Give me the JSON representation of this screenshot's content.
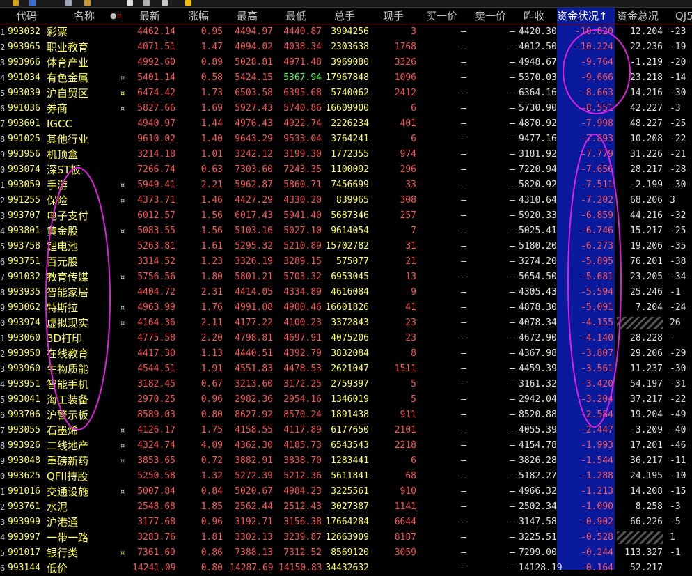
{
  "toolbar": {
    "icons": [
      "bell-icon",
      "bookmark-icon",
      "document-icon",
      "export-icon",
      "settings-icon",
      "grid-icon",
      "warning-icon"
    ]
  },
  "header": {
    "code": "代码",
    "name": "名称",
    "mark": "●¤",
    "latest": "最新",
    "change": "涨幅",
    "high": "最高",
    "low": "最低",
    "volume": "总手",
    "current": "现手",
    "bid": "买一价",
    "ask": "卖一价",
    "prev_close": "昨收",
    "fund_status": "资金状况↑",
    "fund_total": "资金总况",
    "qj": "QJ5"
  },
  "rows": [
    {
      "idx": "1",
      "code": "993032",
      "name": "彩票",
      "mark": "",
      "latest": "4462.14",
      "chg": "0.95",
      "high": "4494.97",
      "low": "4440.87",
      "vol": "3994256",
      "cur": "3",
      "bid": "–",
      "ask": "–",
      "prev": "4420.30",
      "fstat": "-10.820",
      "ftot": "12.204",
      "qj": "-23"
    },
    {
      "idx": "2",
      "code": "993965",
      "name": "职业教育",
      "mark": "",
      "latest": "4071.51",
      "chg": "1.47",
      "high": "4094.02",
      "low": "4038.34",
      "vol": "2303638",
      "cur": "1768",
      "bid": "–",
      "ask": "–",
      "prev": "4012.50",
      "fstat": "-10.224",
      "ftot": "22.236",
      "qj": "-19"
    },
    {
      "idx": "3",
      "code": "993966",
      "name": "体育产业",
      "mark": "",
      "latest": "4992.60",
      "chg": "0.89",
      "high": "5028.81",
      "low": "4971.48",
      "vol": "3969080",
      "cur": "3326",
      "bid": "–",
      "ask": "–",
      "prev": "4948.67",
      "fstat": "-9.764",
      "ftot": "-1.219",
      "qj": "-20"
    },
    {
      "idx": "4",
      "code": "991034",
      "name": "有色金属",
      "mark": "¤",
      "latest": "5401.14",
      "chg": "0.58",
      "high": "5424.15",
      "low": "5367.94",
      "lowGreen": true,
      "vol": "17967848",
      "cur": "1096",
      "bid": "–",
      "ask": "–",
      "prev": "5370.03",
      "fstat": "-9.666",
      "ftot": "23.218",
      "qj": "-14"
    },
    {
      "idx": "5",
      "code": "993039",
      "name": "沪自贸区",
      "mark": "¤",
      "markHl": true,
      "latest": "6474.42",
      "chg": "1.73",
      "high": "6503.58",
      "low": "6395.68",
      "vol": "5740062",
      "cur": "2412",
      "bid": "–",
      "ask": "–",
      "prev": "6364.16",
      "fstat": "-8.663",
      "ftot": "14.216",
      "qj": "-30"
    },
    {
      "idx": "6",
      "code": "991036",
      "name": "券商",
      "mark": "¤",
      "latest": "5827.66",
      "chg": "1.69",
      "high": "5927.43",
      "low": "5740.86",
      "vol": "16609900",
      "cur": "6",
      "bid": "–",
      "ask": "–",
      "prev": "5730.90",
      "fstat": "-8.551",
      "ftot": "42.227",
      "qj": "-3"
    },
    {
      "idx": "7",
      "code": "993601",
      "name": "IGCC",
      "mark": "",
      "latest": "4940.97",
      "chg": "1.44",
      "high": "4976.43",
      "low": "4922.74",
      "vol": "2226234",
      "cur": "401",
      "bid": "–",
      "ask": "–",
      "prev": "4870.92",
      "fstat": "-7.998",
      "ftot": "48.227",
      "qj": "-25"
    },
    {
      "idx": "8",
      "code": "991025",
      "name": "其他行业",
      "mark": "",
      "latest": "9610.02",
      "chg": "1.40",
      "high": "9643.29",
      "low": "9533.04",
      "vol": "3764241",
      "cur": "6",
      "bid": "–",
      "ask": "–",
      "prev": "9477.16",
      "fstat": "-7.893",
      "ftot": "10.208",
      "qj": "-22"
    },
    {
      "idx": "9",
      "code": "993956",
      "name": "机顶盒",
      "mark": "",
      "latest": "3214.18",
      "chg": "1.01",
      "high": "3242.12",
      "low": "3199.30",
      "vol": "1772355",
      "cur": "974",
      "bid": "–",
      "ask": "–",
      "prev": "3181.92",
      "fstat": "-7.779",
      "ftot": "31.226",
      "qj": "-21"
    },
    {
      "idx": "0",
      "code": "993074",
      "name": "深ST板",
      "mark": "",
      "latest": "7266.74",
      "chg": "0.63",
      "high": "7303.60",
      "low": "7243.35",
      "vol": "1100092",
      "cur": "296",
      "bid": "–",
      "ask": "–",
      "prev": "7220.94",
      "fstat": "-7.656",
      "ftot": "28.217",
      "qj": "-28"
    },
    {
      "idx": "1",
      "code": "993059",
      "name": "手游",
      "mark": "¤",
      "latest": "5949.41",
      "chg": "2.21",
      "high": "5962.87",
      "low": "5860.71",
      "vol": "7456699",
      "cur": "33",
      "bid": "–",
      "ask": "–",
      "prev": "5820.92",
      "fstat": "-7.511",
      "ftot": "-2.199",
      "qj": "-30"
    },
    {
      "idx": "2",
      "code": "991255",
      "name": "保险",
      "mark": "¤",
      "latest": "4373.71",
      "chg": "1.46",
      "high": "4427.29",
      "low": "4330.20",
      "vol": "839965",
      "cur": "308",
      "bid": "–",
      "ask": "–",
      "prev": "4310.64",
      "fstat": "-7.202",
      "ftot": "68.206",
      "qj": "3"
    },
    {
      "idx": "3",
      "code": "993707",
      "name": "电子支付",
      "mark": "",
      "latest": "6012.57",
      "chg": "1.56",
      "high": "6017.43",
      "low": "5941.40",
      "vol": "5687346",
      "cur": "257",
      "bid": "–",
      "ask": "–",
      "prev": "5920.33",
      "fstat": "-6.859",
      "ftot": "44.216",
      "qj": "-32"
    },
    {
      "idx": "4",
      "code": "993801",
      "name": "黄金股",
      "mark": "¤",
      "latest": "5083.55",
      "chg": "1.56",
      "high": "5103.16",
      "low": "5027.10",
      "vol": "9614054",
      "cur": "7",
      "bid": "–",
      "ask": "–",
      "prev": "5025.41",
      "fstat": "-6.746",
      "ftot": "15.217",
      "qj": "-25"
    },
    {
      "idx": "5",
      "code": "993758",
      "name": "锂电池",
      "mark": "",
      "latest": "5263.81",
      "chg": "1.61",
      "high": "5295.32",
      "low": "5210.89",
      "vol": "15702782",
      "cur": "31",
      "bid": "–",
      "ask": "–",
      "prev": "5180.20",
      "fstat": "-6.273",
      "ftot": "19.206",
      "qj": "-35"
    },
    {
      "idx": "6",
      "code": "993751",
      "name": "百元股",
      "mark": "",
      "latest": "3314.52",
      "chg": "1.23",
      "high": "3326.19",
      "low": "3289.15",
      "vol": "575077",
      "cur": "21",
      "bid": "–",
      "ask": "–",
      "prev": "3274.20",
      "fstat": "-5.895",
      "ftot": "76.201",
      "qj": "-38"
    },
    {
      "idx": "7",
      "code": "991032",
      "name": "教育传媒",
      "mark": "¤",
      "latest": "5756.56",
      "chg": "1.80",
      "high": "5801.21",
      "low": "5703.32",
      "vol": "6953045",
      "cur": "13",
      "bid": "–",
      "ask": "–",
      "prev": "5654.50",
      "fstat": "-5.681",
      "ftot": "23.205",
      "qj": "-34"
    },
    {
      "idx": "8",
      "code": "993935",
      "name": "智能家居",
      "mark": "",
      "latest": "4404.72",
      "chg": "2.31",
      "high": "4414.05",
      "low": "4334.89",
      "vol": "4616084",
      "cur": "9",
      "bid": "–",
      "ask": "–",
      "prev": "4305.43",
      "fstat": "-5.594",
      "ftot": "25.246",
      "qj": "-1"
    },
    {
      "idx": "9",
      "code": "993062",
      "name": "特斯拉",
      "mark": "¤",
      "latest": "4963.99",
      "chg": "1.76",
      "high": "4991.08",
      "low": "4900.46",
      "vol": "16601826",
      "cur": "41",
      "bid": "–",
      "ask": "–",
      "prev": "4878.30",
      "fstat": "-5.091",
      "ftot": "7.204",
      "qj": "-24"
    },
    {
      "idx": "0",
      "code": "993974",
      "name": "虚拟现实",
      "mark": "¤",
      "latest": "4164.36",
      "chg": "2.11",
      "high": "4177.22",
      "low": "4100.23",
      "vol": "3372843",
      "cur": "23",
      "bid": "–",
      "ask": "–",
      "prev": "4078.34",
      "fstat": "-4.155",
      "ftot": "",
      "hatch": true,
      "qj": "26"
    },
    {
      "idx": "1",
      "code": "993060",
      "name": "3D打印",
      "mark": "",
      "latest": "4775.58",
      "chg": "2.20",
      "high": "4798.81",
      "low": "4697.91",
      "vol": "4075206",
      "cur": "23",
      "bid": "–",
      "ask": "–",
      "prev": "4672.90",
      "fstat": "-4.140",
      "ftot": "28.228",
      "qj": "-"
    },
    {
      "idx": "2",
      "code": "993950",
      "name": "在线教育",
      "mark": "",
      "latest": "4417.30",
      "chg": "1.13",
      "high": "4440.51",
      "low": "4392.79",
      "vol": "3832084",
      "cur": "8",
      "bid": "–",
      "ask": "–",
      "prev": "4367.98",
      "fstat": "-3.807",
      "ftot": "29.206",
      "qj": "-29"
    },
    {
      "idx": "3",
      "code": "993960",
      "name": "生物质能",
      "mark": "",
      "latest": "4544.51",
      "chg": "1.91",
      "high": "4551.83",
      "low": "4478.53",
      "vol": "2621047",
      "cur": "1511",
      "bid": "–",
      "ask": "–",
      "prev": "4459.39",
      "fstat": "-3.561",
      "ftot": "11.237",
      "qj": "-30"
    },
    {
      "idx": "4",
      "code": "993951",
      "name": "智能手机",
      "mark": "",
      "latest": "3182.45",
      "chg": "0.67",
      "high": "3213.60",
      "low": "3172.25",
      "vol": "2759397",
      "cur": "5",
      "bid": "–",
      "ask": "–",
      "prev": "3161.32",
      "fstat": "-3.420",
      "ftot": "54.197",
      "qj": "-31"
    },
    {
      "idx": "5",
      "code": "993041",
      "name": "海工装备",
      "mark": "",
      "latest": "2970.25",
      "chg": "0.96",
      "high": "2982.36",
      "low": "2954.16",
      "vol": "1346019",
      "cur": "5",
      "bid": "–",
      "ask": "–",
      "prev": "2942.04",
      "fstat": "-3.204",
      "ftot": "37.217",
      "qj": "-22"
    },
    {
      "idx": "6",
      "code": "993706",
      "name": "沪警示板",
      "mark": "",
      "latest": "8589.03",
      "chg": "0.80",
      "high": "8627.92",
      "low": "8570.24",
      "vol": "1891438",
      "cur": "911",
      "bid": "–",
      "ask": "–",
      "prev": "8520.88",
      "fstat": "-2.584",
      "ftot": "19.204",
      "qj": "-49"
    },
    {
      "idx": "7",
      "code": "993055",
      "name": "石墨烯",
      "mark": "¤",
      "latest": "4126.17",
      "chg": "1.75",
      "high": "4158.55",
      "low": "4117.89",
      "vol": "6177650",
      "cur": "2101",
      "bid": "–",
      "ask": "–",
      "prev": "4055.39",
      "fstat": "-2.447",
      "ftot": "-3.209",
      "qj": "-40"
    },
    {
      "idx": "8",
      "code": "993926",
      "name": "二线地产",
      "mark": "¤",
      "latest": "4324.74",
      "chg": "4.09",
      "high": "4362.30",
      "low": "4185.73",
      "vol": "6543543",
      "cur": "2218",
      "bid": "–",
      "ask": "–",
      "prev": "4154.78",
      "fstat": "-1.993",
      "ftot": "17.201",
      "qj": "-46"
    },
    {
      "idx": "9",
      "code": "993048",
      "name": "重磅新药",
      "mark": "¤",
      "latest": "3853.65",
      "chg": "0.72",
      "high": "3882.91",
      "low": "3838.70",
      "vol": "1283441",
      "cur": "6",
      "bid": "–",
      "ask": "–",
      "prev": "3826.28",
      "fstat": "-1.544",
      "ftot": "36.217",
      "qj": "-11"
    },
    {
      "idx": "0",
      "code": "993625",
      "name": "QFII持股",
      "mark": "",
      "latest": "5250.58",
      "chg": "1.32",
      "high": "5272.39",
      "low": "5212.36",
      "vol": "5611841",
      "cur": "68",
      "bid": "–",
      "ask": "–",
      "prev": "5182.27",
      "fstat": "-1.288",
      "ftot": "24.195",
      "qj": "-10"
    },
    {
      "idx": "1",
      "code": "991016",
      "name": "交通设施",
      "mark": "¤",
      "latest": "5007.84",
      "chg": "0.84",
      "high": "5020.67",
      "low": "4984.23",
      "vol": "3225561",
      "cur": "910",
      "bid": "–",
      "ask": "–",
      "prev": "4966.32",
      "fstat": "-1.213",
      "ftot": "14.208",
      "qj": "-15"
    },
    {
      "idx": "2",
      "code": "993761",
      "name": "水泥",
      "mark": "",
      "latest": "2548.68",
      "chg": "1.85",
      "high": "2562.44",
      "low": "2512.43",
      "vol": "3027387",
      "cur": "1141",
      "bid": "–",
      "ask": "–",
      "prev": "2502.34",
      "fstat": "-1.090",
      "ftot": "8.258",
      "qj": "-3"
    },
    {
      "idx": "3",
      "code": "993999",
      "name": "沪港通",
      "mark": "",
      "latest": "3177.68",
      "chg": "0.96",
      "high": "3192.71",
      "low": "3156.38",
      "vol": "17664284",
      "cur": "6644",
      "bid": "–",
      "ask": "–",
      "prev": "3147.58",
      "fstat": "-0.902",
      "ftot": "66.226",
      "qj": "-5"
    },
    {
      "idx": "4",
      "code": "993997",
      "name": "一带一路",
      "mark": "",
      "latest": "3283.76",
      "chg": "1.81",
      "high": "3302.13",
      "low": "3239.87",
      "vol": "12663909",
      "cur": "8187",
      "bid": "–",
      "ask": "–",
      "prev": "3225.51",
      "fstat": "-0.528",
      "ftot": "",
      "hatch": true,
      "qj": "1"
    },
    {
      "idx": "5",
      "code": "991017",
      "name": "银行类",
      "mark": "¤",
      "markHl": true,
      "latest": "7361.69",
      "chg": "0.86",
      "high": "7388.13",
      "low": "7312.52",
      "vol": "8569120",
      "cur": "3059",
      "bid": "–",
      "ask": "–",
      "prev": "7299.00",
      "fstat": "-0.244",
      "ftot": "113.327",
      "qj": "-1"
    },
    {
      "idx": "6",
      "code": "993144",
      "name": "低价",
      "mark": "",
      "latest": "14241.09",
      "chg": "0.80",
      "high": "14287.69",
      "low": "14150.83",
      "vol": "34432632",
      "cur": "",
      "bid": "–",
      "ask": "–",
      "prev": "14128.19",
      "fstat": "-0.164",
      "ftot": "52.217",
      "qj": ""
    }
  ]
}
